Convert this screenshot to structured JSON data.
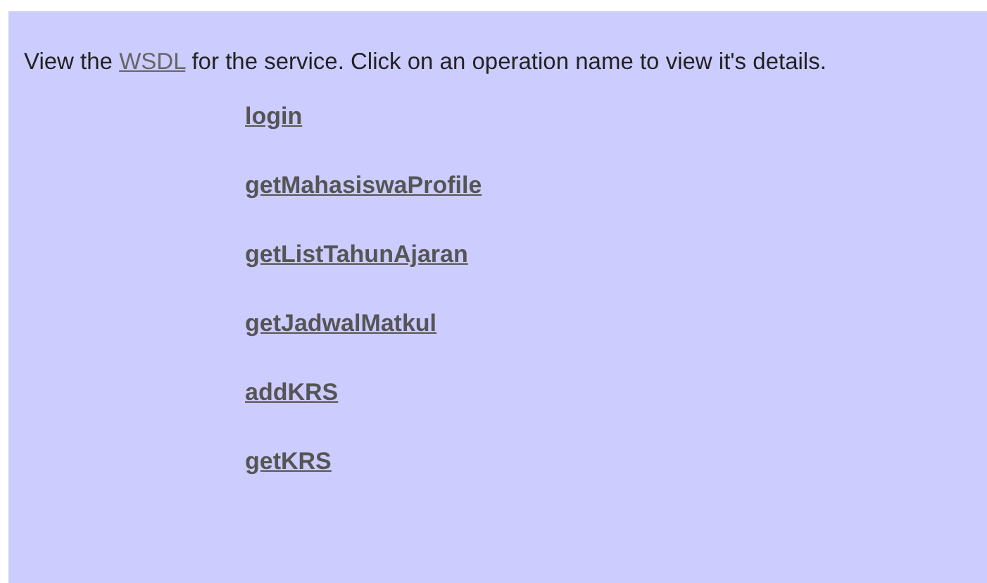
{
  "intro": {
    "before": "View the ",
    "link": "WSDL",
    "after": " for the service. Click on an operation name to view it's details."
  },
  "operations": [
    {
      "name": "login"
    },
    {
      "name": "getMahasiswaProfile"
    },
    {
      "name": "getListTahunAjaran"
    },
    {
      "name": "getJadwalMatkul"
    },
    {
      "name": "addKRS"
    },
    {
      "name": "getKRS"
    }
  ]
}
